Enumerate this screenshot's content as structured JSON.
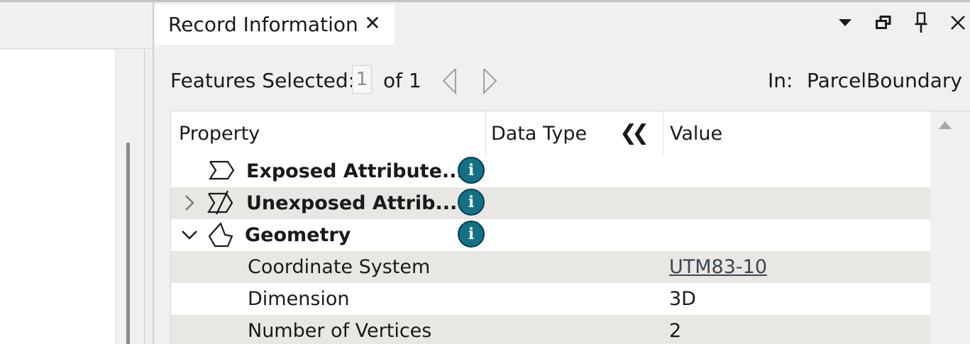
{
  "tab": {
    "title": "Record Information",
    "close_glyph": "✕"
  },
  "window_controls": {
    "dropdown_icon": "dropdown-arrow-icon",
    "float_icon": "float-window-icon",
    "pin_icon": "pin-icon",
    "close_icon": "close-icon"
  },
  "selection": {
    "label": "Features Selected:",
    "current": "1",
    "of_text": "of 1",
    "in_label": "In:",
    "in_value": "ParcelBoundary"
  },
  "table": {
    "headers": {
      "property": "Property",
      "data_type": "Data Type",
      "value": "Value"
    },
    "collapse_glyph": "❮❮",
    "rows": [
      {
        "label": "Exposed Attribute...",
        "icon": "exposed-attributes-icon",
        "bold": true,
        "expander": "",
        "value": ""
      },
      {
        "label": "Unexposed Attrib...",
        "icon": "unexposed-attributes-icon",
        "bold": true,
        "expander": "collapsed",
        "value": ""
      },
      {
        "label": "Geometry",
        "icon": "geometry-icon",
        "bold": true,
        "expander": "expanded",
        "value": ""
      },
      {
        "label": "Coordinate System",
        "value": "UTM83-10"
      },
      {
        "label": "Dimension",
        "value": "3D"
      },
      {
        "label": "Number of Vertices",
        "value": "2"
      }
    ],
    "info_glyph": "i"
  },
  "colors": {
    "info_icon": "#137087",
    "alt_row": "#e9e7e3",
    "panel_bg": "#f0f0f0"
  }
}
